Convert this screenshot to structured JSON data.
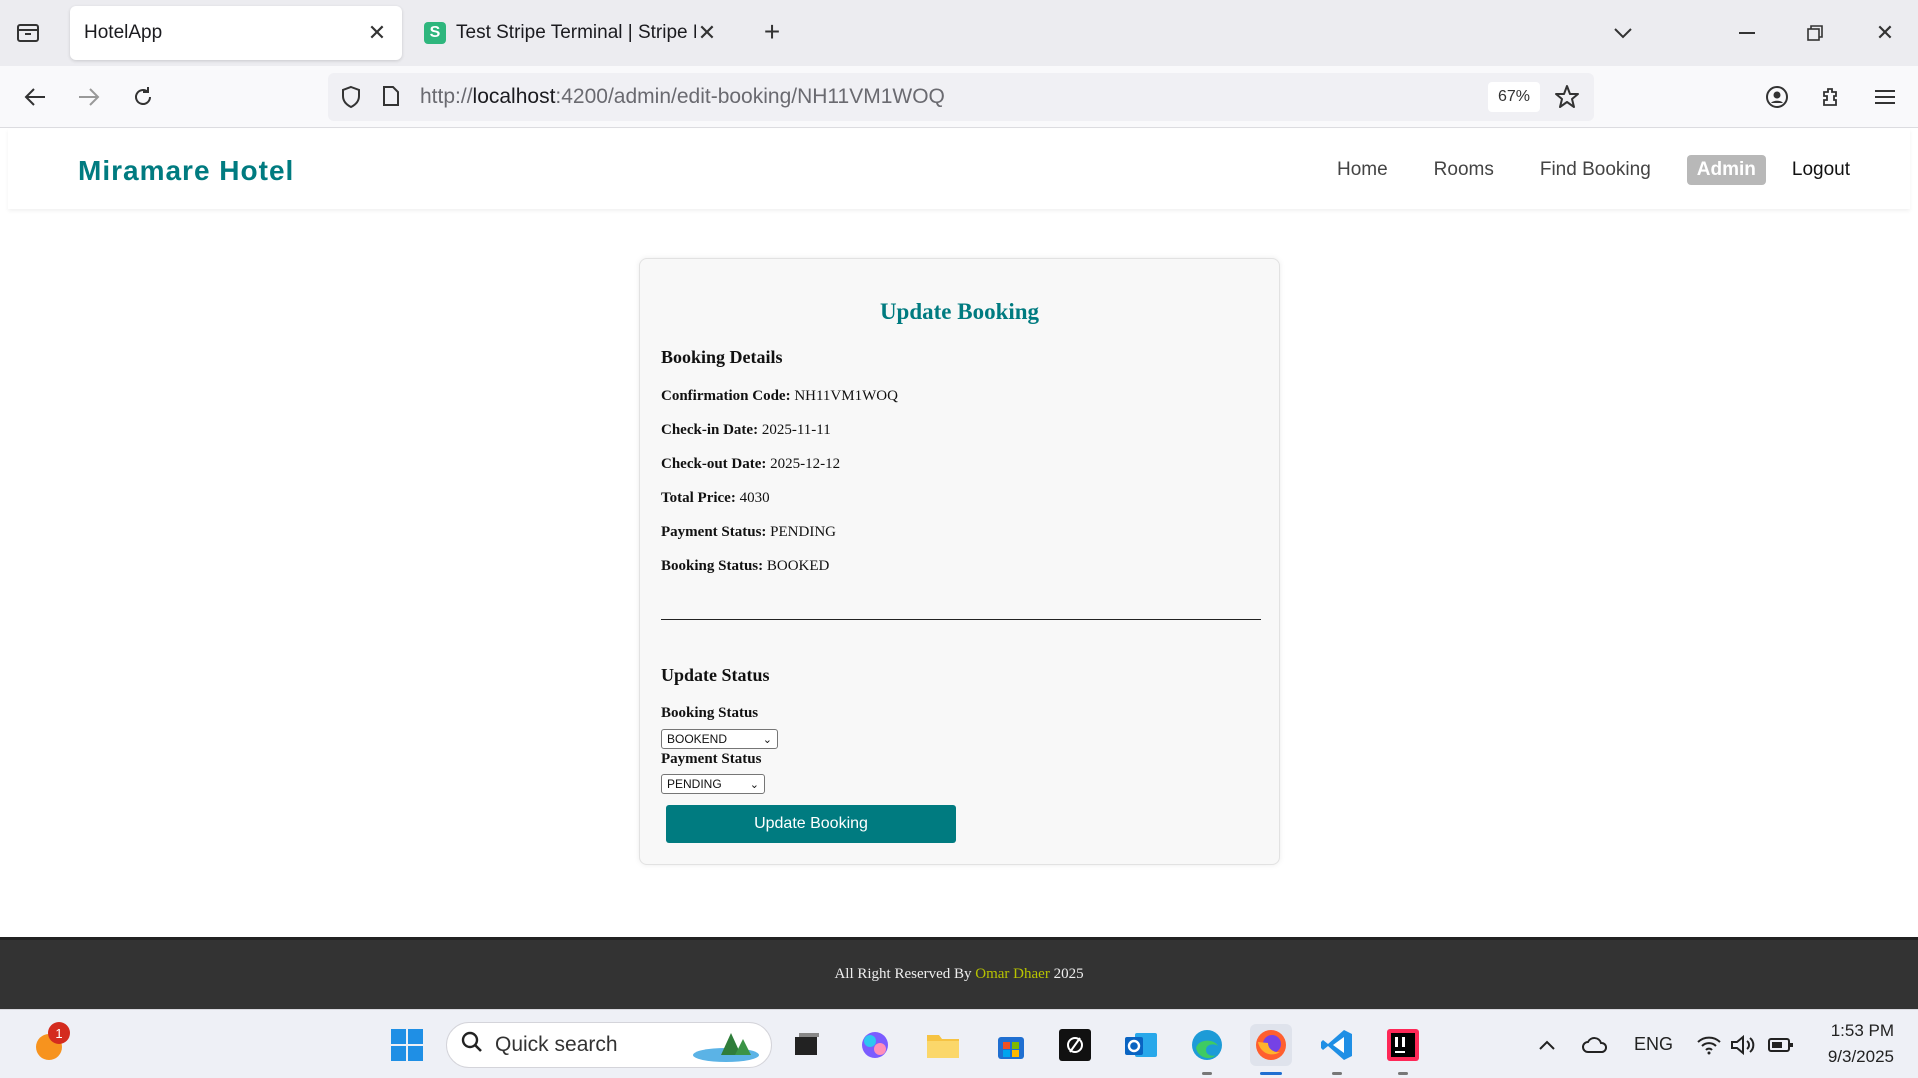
{
  "browser": {
    "tabs": [
      {
        "title": "HotelApp",
        "active": true
      },
      {
        "title": "Test Stripe Terminal | Stripe Doc",
        "favicon": "S",
        "active": false
      }
    ],
    "url_prefix": "http://",
    "url_host": "localhost",
    "url_path": ":4200/admin/edit-booking/NH11VM1WOQ",
    "zoom": "67%"
  },
  "app": {
    "brand": "Miramare Hotel",
    "nav": {
      "home": "Home",
      "rooms": "Rooms",
      "find_booking": "Find Booking",
      "admin": "Admin",
      "logout": "Logout"
    }
  },
  "card": {
    "title": "Update Booking",
    "details_heading": "Booking Details",
    "details": [
      {
        "label": "Confirmation Code:",
        "value": "NH11VM1WOQ"
      },
      {
        "label": "Check-in Date:",
        "value": "2025-11-11"
      },
      {
        "label": "Check-out Date:",
        "value": "2025-12-12"
      },
      {
        "label": "Total Price:",
        "value": "4030"
      },
      {
        "label": "Payment Status:",
        "value": "PENDING"
      },
      {
        "label": "Booking Status:",
        "value": "BOOKED"
      }
    ],
    "update_heading": "Update Status",
    "booking_status_label": "Booking Status",
    "booking_status_value": "BOOKEND",
    "payment_status_label": "Payment Status",
    "payment_status_value": "PENDING",
    "button": "Update Booking"
  },
  "footer": {
    "prefix": "All Right Reserved By ",
    "author": "Omar Dhaer",
    "suffix": " 2025"
  },
  "taskbar": {
    "notification_count": "1",
    "search_placeholder": "Quick search",
    "language": "ENG",
    "time": "1:53 PM",
    "date": "9/3/2025"
  },
  "colors": {
    "accent": "#007b80",
    "footer_bg": "#333333"
  }
}
